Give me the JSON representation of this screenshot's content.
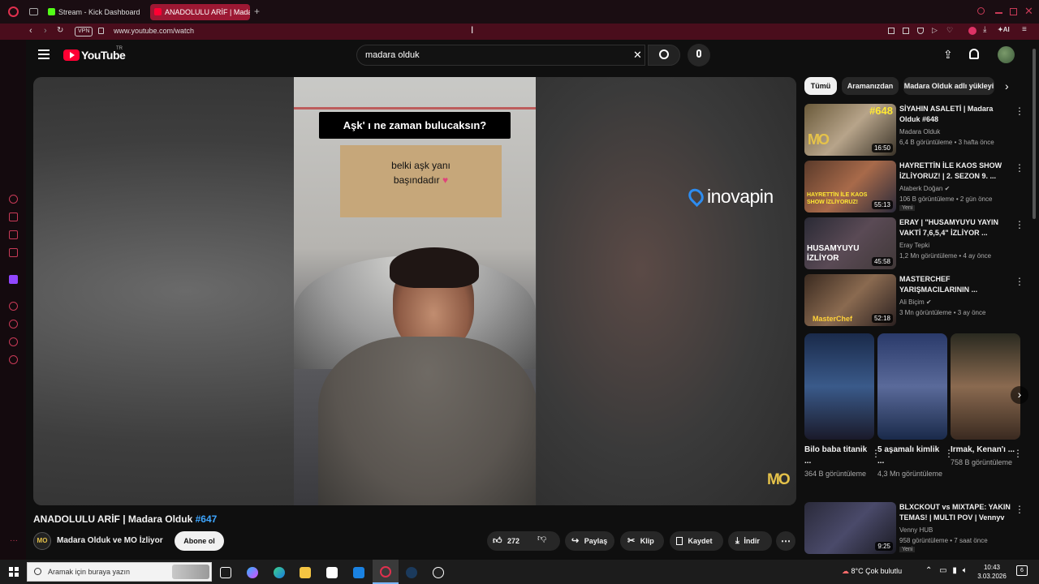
{
  "browser": {
    "tabs": [
      {
        "label": "Stream - Kick Dashboard"
      },
      {
        "label": "ANADOLULU ARİF | Madara Olduk"
      }
    ],
    "vpn": "VPN",
    "url": "www.youtube.com/watch",
    "ai_label": "AI"
  },
  "youtube": {
    "logo": "YouTube",
    "region": "TR",
    "search": {
      "value": "madara olduk"
    }
  },
  "video": {
    "title": "ANADOLULU ARİF | Madara Olduk",
    "hashtag": "#647",
    "channel": "Madara Olduk ve MO İzliyor",
    "subscribe": "Abone ol",
    "likes": "272",
    "share": "Paylaş",
    "clip": "Klip",
    "save": "Kaydet",
    "download": "İndir",
    "overlay": {
      "question": "Aşk' ı ne zaman bulucaksın?",
      "answer_line1": "belki aşk yanı",
      "answer_line2": "başındadır",
      "sponsor": "inovapin",
      "watermark": "MO"
    }
  },
  "sidebar": {
    "chips": [
      "Tümü",
      "Aramanızdan",
      "Madara Olduk adlı yükleyi"
    ],
    "recommendations": [
      {
        "title": "SİYAHIN ASALETİ | Madara Olduk #648",
        "channel": "Madara Olduk",
        "meta": "6,4 B görüntüleme • 3 hafta önce",
        "duration": "16:50",
        "thumb_text": "#648"
      },
      {
        "title": "HAYRETTİN İLE KAOS SHOW İZLİYORUZ! | 2. SEZON 9. ...",
        "channel": "Ataberk Doğan",
        "meta": "106 B görüntüleme • 2 gün önce",
        "duration": "55:13",
        "badge": "Yeni",
        "thumb_text": "HAYRETTİN İLE KAOS SHOW İZLİYORUZ!"
      },
      {
        "title": "ERAY | \"HUSAMYUYU YAYIN VAKTİ 7,6,5,4\" İZLİYOR ...",
        "channel": "Eray Tepki",
        "meta": "1,2 Mn görüntüleme • 4 ay önce",
        "duration": "45:58",
        "thumb_text": "HUSAMYUYU İZLİYOR"
      },
      {
        "title": "MASTERCHEF YARIŞMACILARININ ...",
        "channel": "Ali Biçim",
        "meta": "3 Mn görüntüleme • 3 ay önce",
        "duration": "52:18",
        "thumb_text": "MasterChef"
      }
    ],
    "shorts": [
      {
        "title": "Bilo baba titanik ...",
        "views": "364 B görüntüleme"
      },
      {
        "title": "5 aşamalı kimlik ...",
        "views": "4,3 Mn görüntüleme"
      },
      {
        "title": "Irmak, Kenan'ı ...",
        "views": "758 B görüntüleme"
      }
    ],
    "rec_bottom": {
      "title": "BLXCKOUT vs MIXTAPE: YAKIN TEMAS! | MULTI POV | Vennyv",
      "channel": "Venny HUB",
      "meta": "958 görüntüleme • 7 saat önce",
      "duration": "9:25",
      "badge": "Yeni"
    }
  },
  "taskbar": {
    "search_placeholder": "Aramak için buraya yazın",
    "weather": "8°C  Çok bulutlu",
    "time": "10:43",
    "date": "3.03.2026",
    "notifications": "6"
  },
  "colors": {
    "accent_red": "#ff0033",
    "hashtag_blue": "#3ea6ff",
    "opera_red": "#c83a57"
  }
}
